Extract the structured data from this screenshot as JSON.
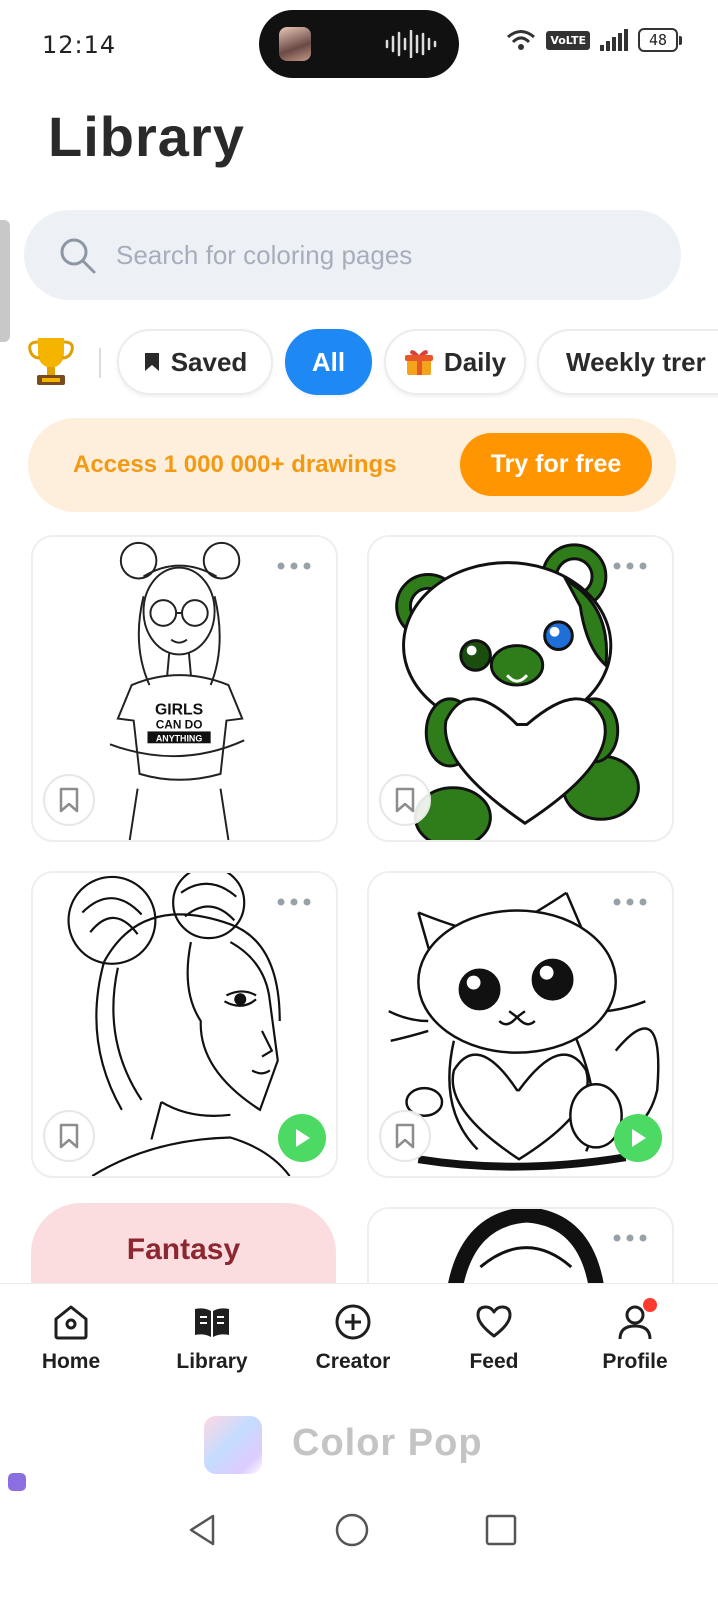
{
  "status_bar": {
    "time": "12:14",
    "network": "VoLTE",
    "battery": "48"
  },
  "header": {
    "title": "Library"
  },
  "search": {
    "placeholder": "Search for coloring pages",
    "value": ""
  },
  "filters": [
    {
      "label": "Saved",
      "icon": "bookmark-icon",
      "selected": false
    },
    {
      "label": "All",
      "selected": true
    },
    {
      "label": "Daily",
      "icon": "gift-icon",
      "selected": false
    },
    {
      "label": "Weekly trer",
      "selected": false
    }
  ],
  "promo": {
    "text": "Access 1 000 000+ drawings",
    "button": "Try for free"
  },
  "cards": [
    {
      "subject": "girl-with-glasses-shirt",
      "shirt_text": [
        "GIRLS",
        "CAN DO",
        "ANYTHING"
      ],
      "play": false
    },
    {
      "subject": "teddy-bear-with-heart",
      "play": false
    },
    {
      "subject": "girl-with-hair-buns",
      "play": true
    },
    {
      "subject": "kitten-with-heart",
      "play": true
    }
  ],
  "category_tile": {
    "label": "Fantasy"
  },
  "bottom_nav": [
    {
      "label": "Home",
      "icon": "home-icon"
    },
    {
      "label": "Library",
      "icon": "book-icon"
    },
    {
      "label": "Creator",
      "icon": "plus-circle-icon"
    },
    {
      "label": "Feed",
      "icon": "heart-icon"
    },
    {
      "label": "Profile",
      "icon": "person-icon"
    }
  ],
  "watermark": {
    "text": "Color Pop"
  },
  "colors": {
    "accent": "#1e88f5",
    "promo_orange": "#ff9500",
    "play_green": "#4cd964",
    "notification": "#ff3b30"
  }
}
